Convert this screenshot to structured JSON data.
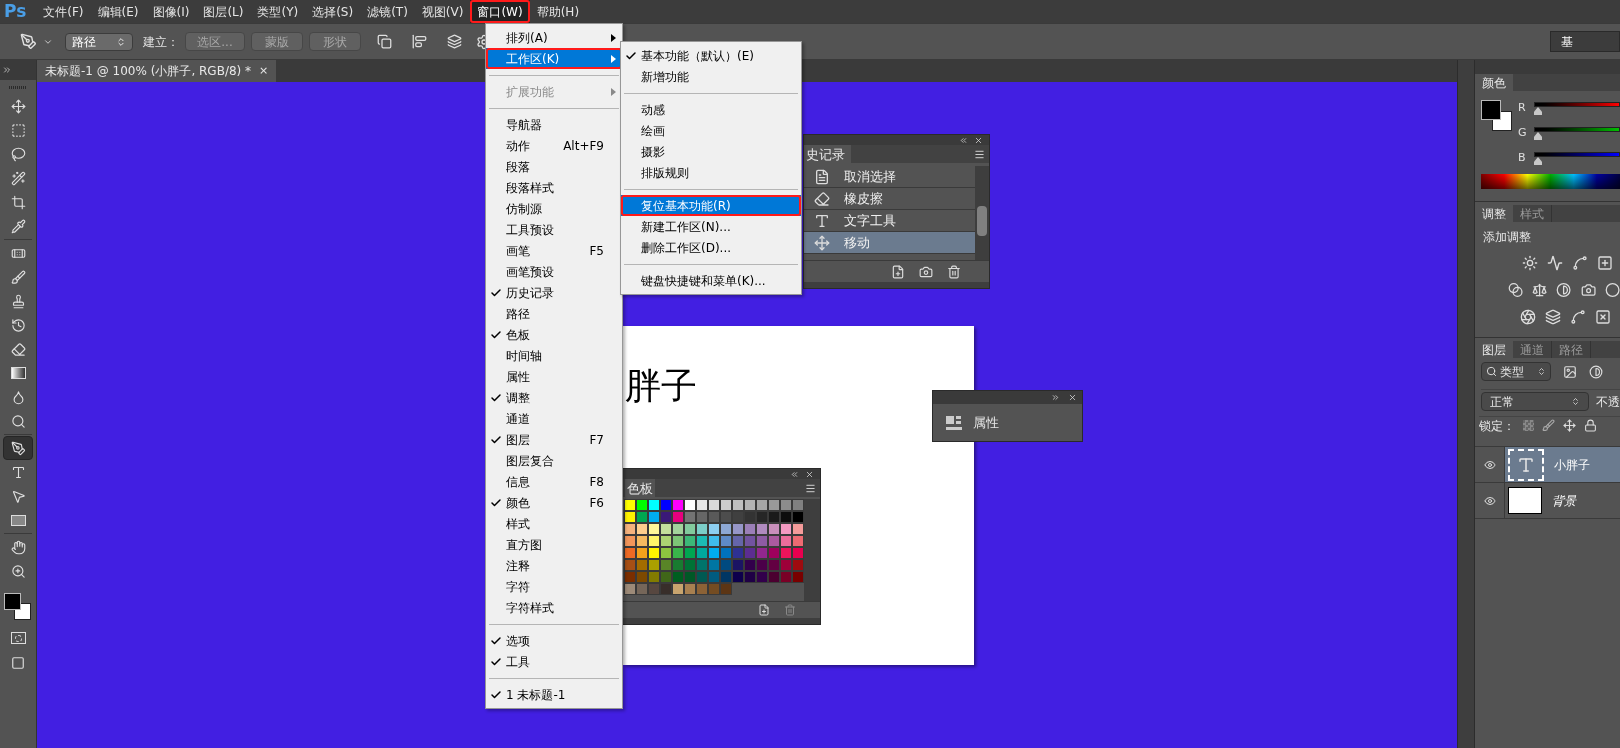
{
  "menu_bar": {
    "logo": "Ps",
    "items": [
      {
        "label": "文件(F)",
        "selected": false,
        "annotated": false
      },
      {
        "label": "编辑(E)",
        "selected": false,
        "annotated": false
      },
      {
        "label": "图像(I)",
        "selected": false,
        "annotated": false
      },
      {
        "label": "图层(L)",
        "selected": false,
        "annotated": false
      },
      {
        "label": "类型(Y)",
        "selected": false,
        "annotated": false
      },
      {
        "label": "选择(S)",
        "selected": false,
        "annotated": false
      },
      {
        "label": "滤镜(T)",
        "selected": false,
        "annotated": false
      },
      {
        "label": "视图(V)",
        "selected": false,
        "annotated": false
      },
      {
        "label": "窗口(W)",
        "selected": true,
        "annotated": true
      },
      {
        "label": "帮助(H)",
        "selected": false,
        "annotated": false
      }
    ]
  },
  "options_bar": {
    "mode": "路径",
    "make_label": "建立：",
    "buttons": [
      "选区...",
      "蒙版",
      "形状"
    ],
    "right_button": "基"
  },
  "tools": [
    {
      "kind": "move",
      "selected": false
    },
    {
      "kind": "marquee",
      "selected": false
    },
    {
      "kind": "lasso",
      "selected": false
    },
    {
      "kind": "quick-select",
      "selected": false
    },
    {
      "kind": "crop",
      "selected": false
    },
    {
      "kind": "eyedropper",
      "selected": false
    },
    {
      "kind": "healing",
      "selected": false
    },
    {
      "kind": "brush",
      "selected": false
    },
    {
      "kind": "stamp",
      "selected": false
    },
    {
      "kind": "history-brush",
      "selected": false
    },
    {
      "kind": "eraser",
      "selected": false
    },
    {
      "kind": "gradient",
      "selected": false
    },
    {
      "kind": "blur",
      "selected": false
    },
    {
      "kind": "dodge",
      "selected": false
    },
    {
      "kind": "pen",
      "selected": true
    },
    {
      "kind": "type",
      "selected": false
    },
    {
      "kind": "path-select",
      "selected": false
    },
    {
      "kind": "shape",
      "selected": false
    },
    {
      "kind": "hand",
      "selected": false
    },
    {
      "kind": "zoom",
      "selected": false
    }
  ],
  "document": {
    "tab_title": "未标题-1 @ 100% (小胖子, RGB/8) *",
    "close": "×",
    "canvas_text": "胖子"
  },
  "window_menu": {
    "items": [
      {
        "kind": "item",
        "label": "排列(A)",
        "submenu": true,
        "checked": false,
        "selected": false,
        "disabled": false,
        "annotated": false
      },
      {
        "kind": "item",
        "label": "工作区(K)",
        "submenu": true,
        "checked": false,
        "selected": true,
        "disabled": false,
        "annotated": true
      },
      {
        "kind": "separator"
      },
      {
        "kind": "item",
        "label": "扩展功能",
        "submenu": true,
        "checked": false,
        "selected": false,
        "disabled": true,
        "annotated": false
      },
      {
        "kind": "separator"
      },
      {
        "kind": "item",
        "label": "导航器",
        "submenu": false,
        "checked": false,
        "selected": false,
        "disabled": false,
        "annotated": false
      },
      {
        "kind": "item",
        "label": "动作",
        "shortcut": "Alt+F9",
        "submenu": false,
        "checked": false,
        "selected": false,
        "disabled": false,
        "annotated": false
      },
      {
        "kind": "item",
        "label": "段落",
        "submenu": false,
        "checked": false,
        "selected": false,
        "disabled": false,
        "annotated": false
      },
      {
        "kind": "item",
        "label": "段落样式",
        "submenu": false,
        "checked": false,
        "selected": false,
        "disabled": false,
        "annotated": false
      },
      {
        "kind": "item",
        "label": "仿制源",
        "submenu": false,
        "checked": false,
        "selected": false,
        "disabled": false,
        "annotated": false
      },
      {
        "kind": "item",
        "label": "工具预设",
        "submenu": false,
        "checked": false,
        "selected": false,
        "disabled": false,
        "annotated": false
      },
      {
        "kind": "item",
        "label": "画笔",
        "shortcut": "F5",
        "submenu": false,
        "checked": false,
        "selected": false,
        "disabled": false,
        "annotated": false
      },
      {
        "kind": "item",
        "label": "画笔预设",
        "submenu": false,
        "checked": false,
        "selected": false,
        "disabled": false,
        "annotated": false
      },
      {
        "kind": "item",
        "label": "历史记录",
        "submenu": false,
        "checked": true,
        "selected": false,
        "disabled": false,
        "annotated": false
      },
      {
        "kind": "item",
        "label": "路径",
        "submenu": false,
        "checked": false,
        "selected": false,
        "disabled": false,
        "annotated": false
      },
      {
        "kind": "item",
        "label": "色板",
        "submenu": false,
        "checked": true,
        "selected": false,
        "disabled": false,
        "annotated": false
      },
      {
        "kind": "item",
        "label": "时间轴",
        "submenu": false,
        "checked": false,
        "selected": false,
        "disabled": false,
        "annotated": false
      },
      {
        "kind": "item",
        "label": "属性",
        "submenu": false,
        "checked": false,
        "selected": false,
        "disabled": false,
        "annotated": false
      },
      {
        "kind": "item",
        "label": "调整",
        "submenu": false,
        "checked": true,
        "selected": false,
        "disabled": false,
        "annotated": false
      },
      {
        "kind": "item",
        "label": "通道",
        "submenu": false,
        "checked": false,
        "selected": false,
        "disabled": false,
        "annotated": false
      },
      {
        "kind": "item",
        "label": "图层",
        "shortcut": "F7",
        "submenu": false,
        "checked": true,
        "selected": false,
        "disabled": false,
        "annotated": false
      },
      {
        "kind": "item",
        "label": "图层复合",
        "submenu": false,
        "checked": false,
        "selected": false,
        "disabled": false,
        "annotated": false
      },
      {
        "kind": "item",
        "label": "信息",
        "shortcut": "F8",
        "submenu": false,
        "checked": false,
        "selected": false,
        "disabled": false,
        "annotated": false
      },
      {
        "kind": "item",
        "label": "颜色",
        "shortcut": "F6",
        "submenu": false,
        "checked": true,
        "selected": false,
        "disabled": false,
        "annotated": false
      },
      {
        "kind": "item",
        "label": "样式",
        "submenu": false,
        "checked": false,
        "selected": false,
        "disabled": false,
        "annotated": false
      },
      {
        "kind": "item",
        "label": "直方图",
        "submenu": false,
        "checked": false,
        "selected": false,
        "disabled": false,
        "annotated": false
      },
      {
        "kind": "item",
        "label": "注释",
        "submenu": false,
        "checked": false,
        "selected": false,
        "disabled": false,
        "annotated": false
      },
      {
        "kind": "item",
        "label": "字符",
        "submenu": false,
        "checked": false,
        "selected": false,
        "disabled": false,
        "annotated": false
      },
      {
        "kind": "item",
        "label": "字符样式",
        "submenu": false,
        "checked": false,
        "selected": false,
        "disabled": false,
        "annotated": false
      },
      {
        "kind": "separator"
      },
      {
        "kind": "item",
        "label": "选项",
        "submenu": false,
        "checked": true,
        "selected": false,
        "disabled": false,
        "annotated": false
      },
      {
        "kind": "item",
        "label": "工具",
        "submenu": false,
        "checked": true,
        "selected": false,
        "disabled": false,
        "annotated": false
      },
      {
        "kind": "separator"
      },
      {
        "kind": "item",
        "label": "1 未标题-1",
        "submenu": false,
        "checked": true,
        "selected": false,
        "disabled": false,
        "annotated": false
      }
    ]
  },
  "workspace_submenu": {
    "items": [
      {
        "kind": "item",
        "label": "基本功能（默认）(E)",
        "checked": true,
        "selected": false,
        "annotated": false
      },
      {
        "kind": "item",
        "label": "新增功能",
        "checked": false,
        "selected": false,
        "annotated": false
      },
      {
        "kind": "separator"
      },
      {
        "kind": "item",
        "label": "动感",
        "checked": false,
        "selected": false,
        "annotated": false
      },
      {
        "kind": "item",
        "label": "绘画",
        "checked": false,
        "selected": false,
        "annotated": false
      },
      {
        "kind": "item",
        "label": "摄影",
        "checked": false,
        "selected": false,
        "annotated": false
      },
      {
        "kind": "item",
        "label": "排版规则",
        "checked": false,
        "selected": false,
        "annotated": false
      },
      {
        "kind": "separator"
      },
      {
        "kind": "item",
        "label": "复位基本功能(R)",
        "checked": false,
        "selected": true,
        "annotated": true
      },
      {
        "kind": "item",
        "label": "新建工作区(N)...",
        "checked": false,
        "selected": false,
        "annotated": false
      },
      {
        "kind": "item",
        "label": "删除工作区(D)...",
        "checked": false,
        "selected": false,
        "annotated": false
      },
      {
        "kind": "separator"
      },
      {
        "kind": "item",
        "label": "键盘快捷键和菜单(K)...",
        "checked": false,
        "selected": false,
        "annotated": false
      }
    ]
  },
  "history_panel": {
    "tab": "史记录",
    "items": [
      {
        "kind": "document",
        "label": "取消选择",
        "selected": false
      },
      {
        "kind": "eraser",
        "label": "橡皮擦",
        "selected": false
      },
      {
        "kind": "type",
        "label": "文字工具",
        "selected": false
      },
      {
        "kind": "move",
        "label": "移动",
        "selected": true
      }
    ]
  },
  "properties_panel": {
    "label": "属性"
  },
  "swatches_panel": {
    "tab": "色板"
  },
  "color_panel": {
    "tab": "颜色",
    "channels": [
      {
        "name": "R",
        "level": 0
      },
      {
        "name": "G",
        "level": 0
      },
      {
        "name": "B",
        "level": 0
      }
    ]
  },
  "adjustments_panel": {
    "tabs": [
      {
        "label": "调整",
        "selected": true
      },
      {
        "label": "样式",
        "selected": false
      }
    ],
    "heading": "添加调整"
  },
  "layers_panel": {
    "tabs": [
      {
        "label": "图层",
        "selected": true
      },
      {
        "label": "通道",
        "selected": false
      },
      {
        "label": "路径",
        "selected": false
      }
    ],
    "filter": "类型",
    "blend_mode": "正常",
    "opacity_label": "不透",
    "lock_label": "锁定：",
    "layers": [
      {
        "kind": "text",
        "name": "小胖子",
        "selected": true,
        "visible": true
      },
      {
        "kind": "fill",
        "name": "背景",
        "selected": false,
        "visible": true
      }
    ]
  }
}
